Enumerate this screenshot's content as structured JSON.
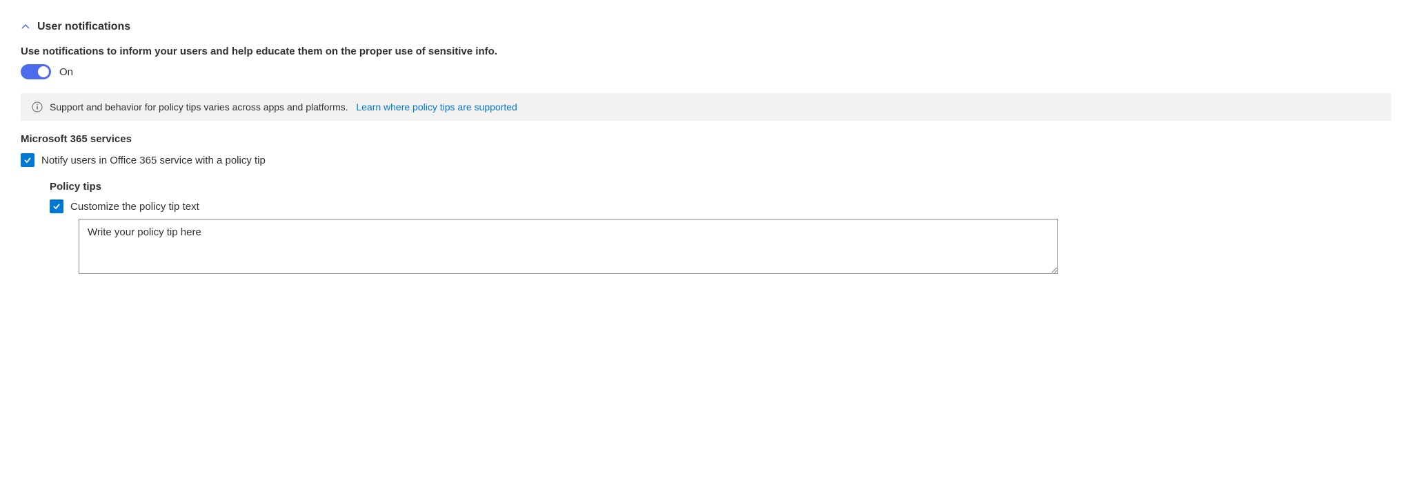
{
  "section": {
    "title": "User notifications",
    "description": "Use notifications to inform your users and help educate them on the proper use of sensitive info."
  },
  "toggle": {
    "state_label": "On",
    "checked": true
  },
  "info": {
    "text": "Support and behavior for policy tips varies across apps and platforms.",
    "link_text": "Learn where policy tips are supported"
  },
  "subsection": {
    "title": "Microsoft 365 services"
  },
  "checkboxes": {
    "notify_users": {
      "label": "Notify users in Office 365 service with a policy tip",
      "checked": true
    },
    "customize": {
      "label": "Customize the policy tip text",
      "checked": true
    }
  },
  "policy_tips": {
    "title": "Policy tips",
    "textarea_value": "Write your policy tip here"
  }
}
